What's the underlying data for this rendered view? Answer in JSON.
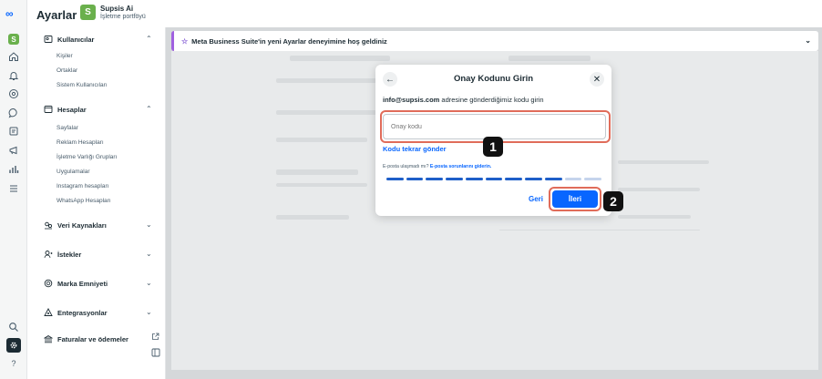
{
  "app": {
    "logo": "∞",
    "title": "Ayarlar",
    "account_initial": "S",
    "account_name": "Supsis Ai",
    "account_subtitle": "İşletme portföyü"
  },
  "rail": {
    "account_initial": "S",
    "icons": [
      "home-icon",
      "bell-icon",
      "at-icon",
      "chat-icon",
      "pages-icon",
      "megaphone-icon",
      "chart-icon",
      "menu-icon",
      "search-icon",
      "gear-icon",
      "help-icon"
    ],
    "help_glyph": "?"
  },
  "sidebar": {
    "kullanicilar": {
      "label": "Kullanıcılar",
      "items": [
        "Kişiler",
        "Ortaklar",
        "Sistem Kullanıcıları"
      ]
    },
    "hesaplar": {
      "label": "Hesaplar",
      "items": [
        "Sayfalar",
        "Reklam Hesapları",
        "İşletme Varlığı Grupları",
        "Uygulamalar",
        "Instagram hesapları",
        "WhatsApp Hesapları"
      ]
    },
    "veri_kaynaklari": "Veri Kaynakları",
    "istekler": "İstekler",
    "marka_emniyeti": "Marka Emniyeti",
    "entegrasyonlar": "Entegrasyonlar",
    "faturalar": "Faturalar ve ödemeler"
  },
  "banner": {
    "text": "Meta Business Suite'in yeni Ayarlar deneyimine hoş geldiniz"
  },
  "dialog": {
    "title": "Onay Kodunu Girin",
    "email": "info@supsis.com",
    "instruction_rest": " adresine gönderdiğimiz kodu girin",
    "input_placeholder": "Onay kodu",
    "resend": "Kodu tekrar gönder",
    "problem_prefix": "E-posta ulaşmadı mı? ",
    "problem_link": "E-posta sorunlarını giderin.",
    "progress_total": 11,
    "progress_filled": 9,
    "back_label": "Geri",
    "next_label": "İleri"
  },
  "markers": [
    "1",
    "2"
  ],
  "colors": {
    "accent": "#0866ff",
    "highlight": "#e06c5a",
    "account_green": "#6ab04c",
    "banner_purple": "#a060e0"
  }
}
